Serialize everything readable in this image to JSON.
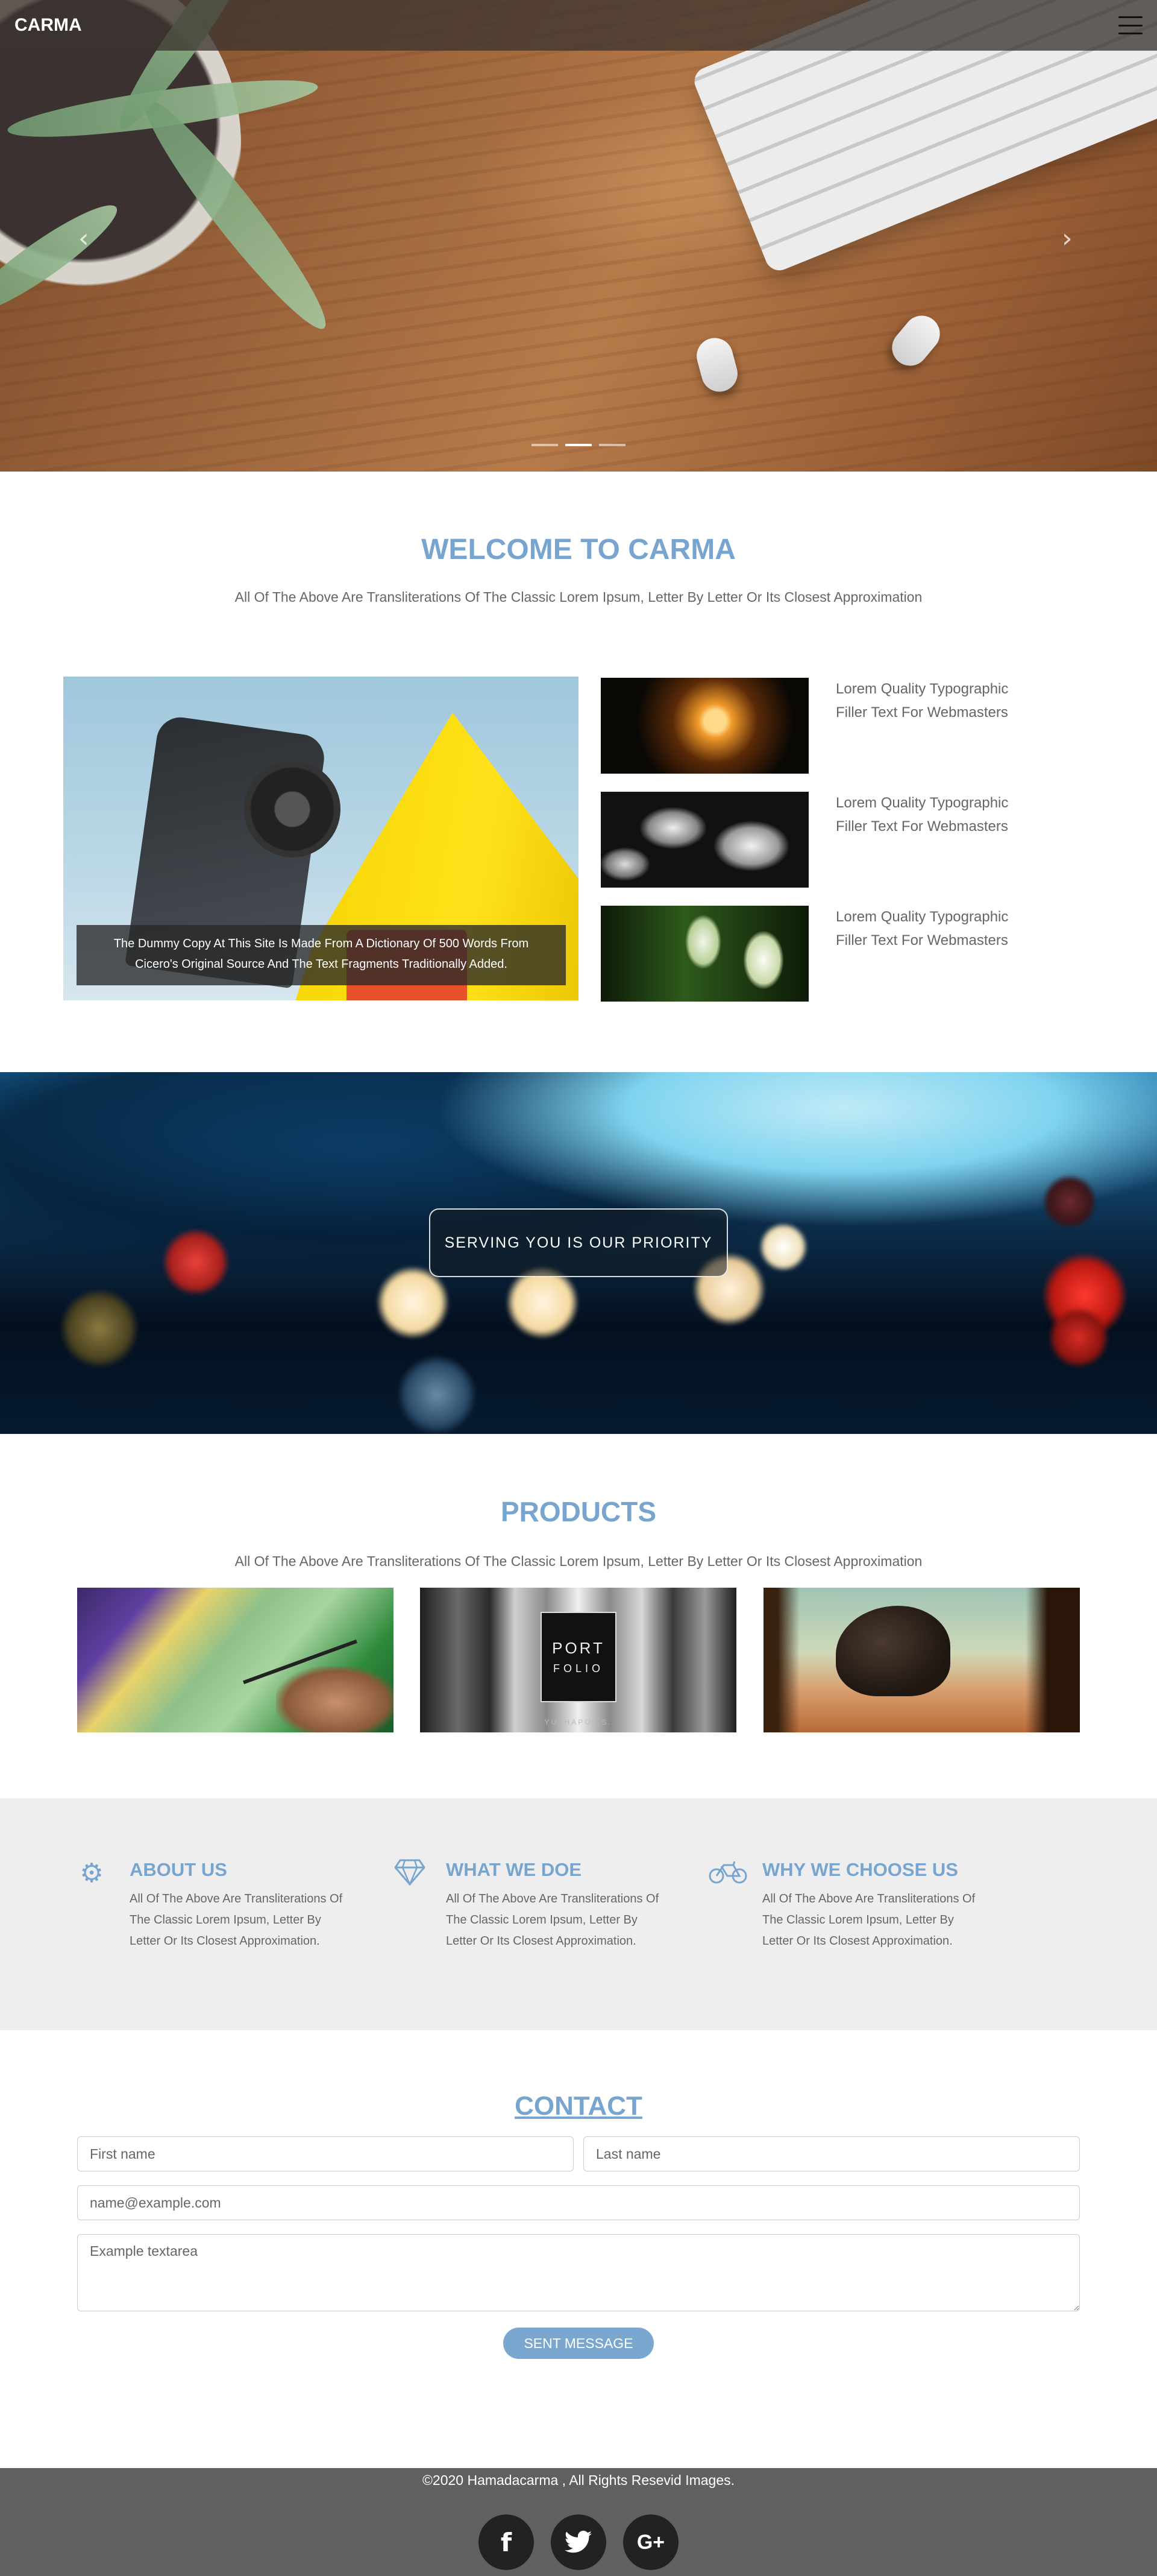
{
  "nav": {
    "brand": "CARMA"
  },
  "hero": {
    "prev_icon": "chevron-left-icon",
    "next_icon": "chevron-right-icon",
    "slides": 3,
    "active_slide": 2
  },
  "welcome": {
    "title": "WELCOME TO CARMA",
    "subtitle": "All Of The Above Are Transliterations Of The Classic Lorem Ipsum, Letter By Letter Or Its Closest Approximation",
    "caption_line1": "The Dummy Copy At This Site Is Made From A Dictionary Of 500 Words From",
    "caption_line2": "Cicero's Original Source And The Text Fragments Traditionally Added.",
    "items": [
      {
        "line1": "Lorem Quality Typographic",
        "line2": "Filler Text For Webmasters"
      },
      {
        "line1": "Lorem Quality Typographic",
        "line2": "Filler Text For Webmasters"
      },
      {
        "line1": "Lorem Quality Typographic",
        "line2": "Filler Text For Webmasters"
      }
    ]
  },
  "banner": {
    "button": "SERVING YOU IS OUR PRIORITY"
  },
  "products": {
    "title": "PRODUCTS",
    "subtitle": "All Of The Above Are Transliterations Of The Classic Lorem Ipsum, Letter By Letter Or Its Closest Approximation",
    "portfolio_word1": "PORT",
    "portfolio_word2": "FOLIO",
    "portfolio_credit": "YUTHAPOL S."
  },
  "features": [
    {
      "icon": "gears-icon",
      "title": "ABOUT US",
      "l1": "All Of The Above Are Transliterations Of",
      "l2": "The Classic Lorem Ipsum, Letter By",
      "l3": "Letter Or Its Closest Approximation."
    },
    {
      "icon": "diamond-icon",
      "title": "WHAT WE DOE",
      "l1": "All Of The Above Are Transliterations Of",
      "l2": "The Classic Lorem Ipsum, Letter By",
      "l3": "Letter Or Its Closest Approximation."
    },
    {
      "icon": "bicycle-icon",
      "title": "WHY WE CHOOSE US",
      "l1": "All Of The Above Are Transliterations Of",
      "l2": "The Classic Lorem Ipsum, Letter By",
      "l3": "Letter Or Its Closest Approximation."
    }
  ],
  "contact": {
    "title": "CONTACT",
    "first_name_placeholder": "First name",
    "last_name_placeholder": "Last name",
    "email_placeholder": "name@example.com",
    "message_placeholder": "Example textarea",
    "send_label": "SENT MESSAGE"
  },
  "footer": {
    "copyright": "©2020 Hamadacarma , All Rights Resevid Images.",
    "social": [
      {
        "icon": "facebook-icon",
        "glyph": "f"
      },
      {
        "icon": "twitter-icon",
        "glyph": "🐦"
      },
      {
        "icon": "google-plus-icon",
        "glyph": "G+"
      }
    ]
  },
  "colors": {
    "accent": "#77a5cf",
    "footer": "#606060",
    "grey_section": "#eeeeee"
  }
}
